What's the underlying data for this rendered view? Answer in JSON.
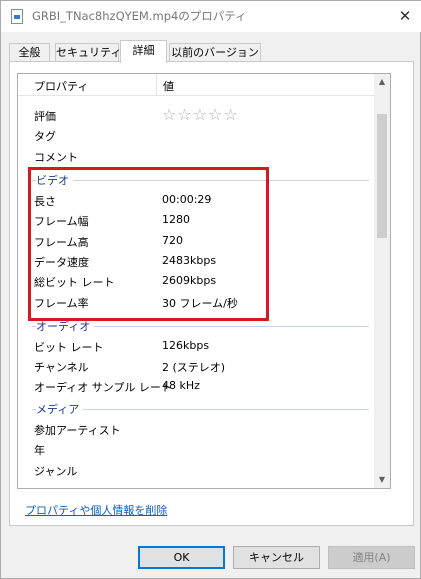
{
  "window": {
    "title": "GRBI_TNac8hzQYEM.mp4のプロパティ",
    "close_symbol": "✕"
  },
  "tabs": [
    {
      "label": "全般",
      "active": false
    },
    {
      "label": "セキュリティ",
      "active": false
    },
    {
      "label": "詳細",
      "active": true
    },
    {
      "label": "以前のバージョン",
      "active": false
    }
  ],
  "list": {
    "header": {
      "property": "プロパティ",
      "value": "値"
    },
    "rows_top": [
      {
        "property": "評価",
        "value": "☆☆☆☆☆"
      },
      {
        "property": "タグ",
        "value": ""
      },
      {
        "property": "コメント",
        "value": ""
      }
    ],
    "group_video": "ビデオ",
    "video_rows": [
      {
        "property": "長さ",
        "value": "00:00:29"
      },
      {
        "property": "フレーム幅",
        "value": "1280"
      },
      {
        "property": "フレーム高",
        "value": "720"
      },
      {
        "property": "データ速度",
        "value": "2483kbps"
      },
      {
        "property": "総ビット レート",
        "value": "2609kbps"
      },
      {
        "property": "フレーム率",
        "value": "30 フレーム/秒"
      }
    ],
    "group_audio": "オーディオ",
    "audio_rows": [
      {
        "property": "ビット レート",
        "value": "126kbps"
      },
      {
        "property": "チャンネル",
        "value": "2 (ステレオ)"
      },
      {
        "property": "オーディオ サンプル レート",
        "value": "48 kHz"
      }
    ],
    "group_media": "メディア",
    "media_rows": [
      {
        "property": "参加アーティスト",
        "value": ""
      },
      {
        "property": "年",
        "value": ""
      },
      {
        "property": "ジャンル",
        "value": ""
      }
    ],
    "scroll_up_symbol": "▲",
    "scroll_down_symbol": "▼"
  },
  "remove_link": "プロパティや個人情報を削除",
  "buttons": {
    "ok": "OK",
    "cancel": "キャンセル",
    "apply": "適用(A)"
  },
  "colors": {
    "highlight_border": "#d7191f",
    "link": "#0a5fc2",
    "group_label": "#1e3a8a"
  }
}
